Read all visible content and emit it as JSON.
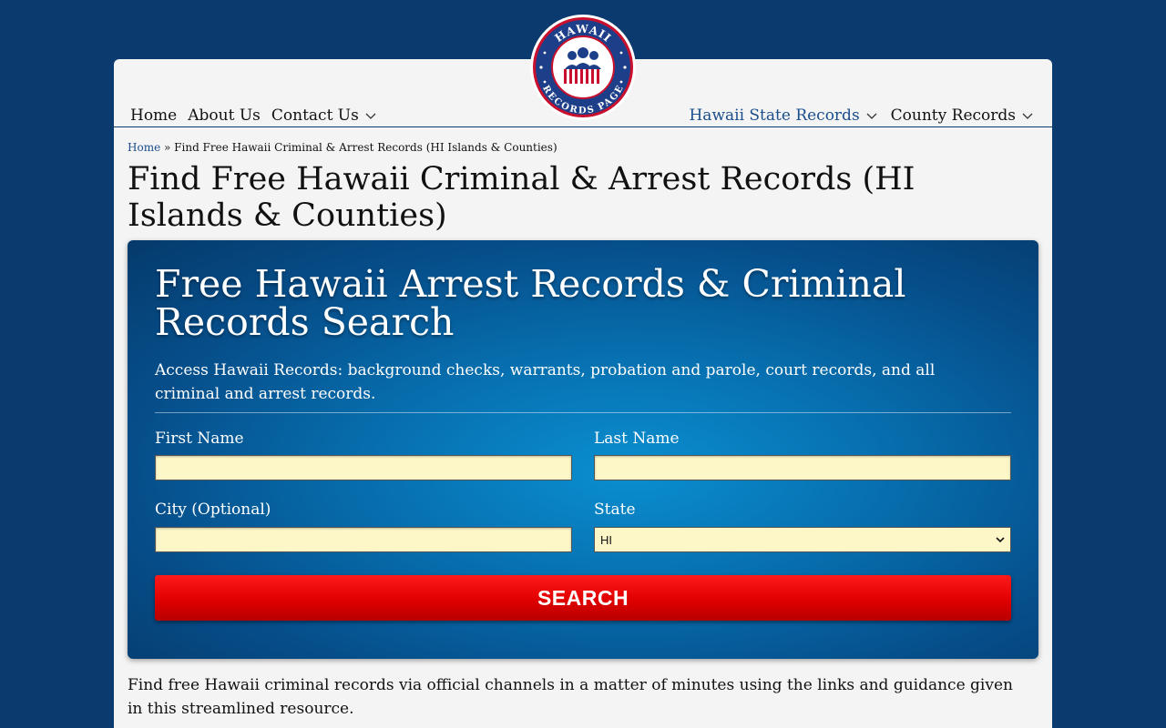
{
  "logo": {
    "top_text": "HAWAII",
    "bottom_text": "RECORDS PAGE"
  },
  "nav": {
    "left": [
      {
        "label": "Home"
      },
      {
        "label": "About Us"
      },
      {
        "label": "Contact Us"
      }
    ],
    "right": [
      {
        "label": "Hawaii State Records"
      },
      {
        "label": "County Records"
      }
    ]
  },
  "breadcrumb": {
    "home": "Home",
    "separator": "»",
    "current": "Find Free Hawaii Criminal & Arrest Records (HI Islands & Counties)"
  },
  "page_title": "Find Free Hawaii Criminal & Arrest Records (HI Islands & Counties)",
  "hero": {
    "title": "Free Hawaii Arrest Records & Criminal Records Search",
    "description": "Access Hawaii Records: background checks, warrants, probation and parole, court records, and all criminal and arrest records.",
    "form": {
      "first_name_label": "First Name",
      "first_name_value": "",
      "last_name_label": "Last Name",
      "last_name_value": "",
      "city_label": "City (Optional)",
      "city_value": "",
      "state_label": "State",
      "state_value": "HI",
      "search_label": "SEARCH"
    }
  },
  "intro": "Find free Hawaii criminal records via official channels in a matter of minutes using the links and guidance given in this streamlined resource.",
  "colors": {
    "background": "#0b3a6e",
    "nav_accent": "#1a4d8c",
    "input_bg": "#fdf7c8",
    "button_red": "#e00000"
  }
}
